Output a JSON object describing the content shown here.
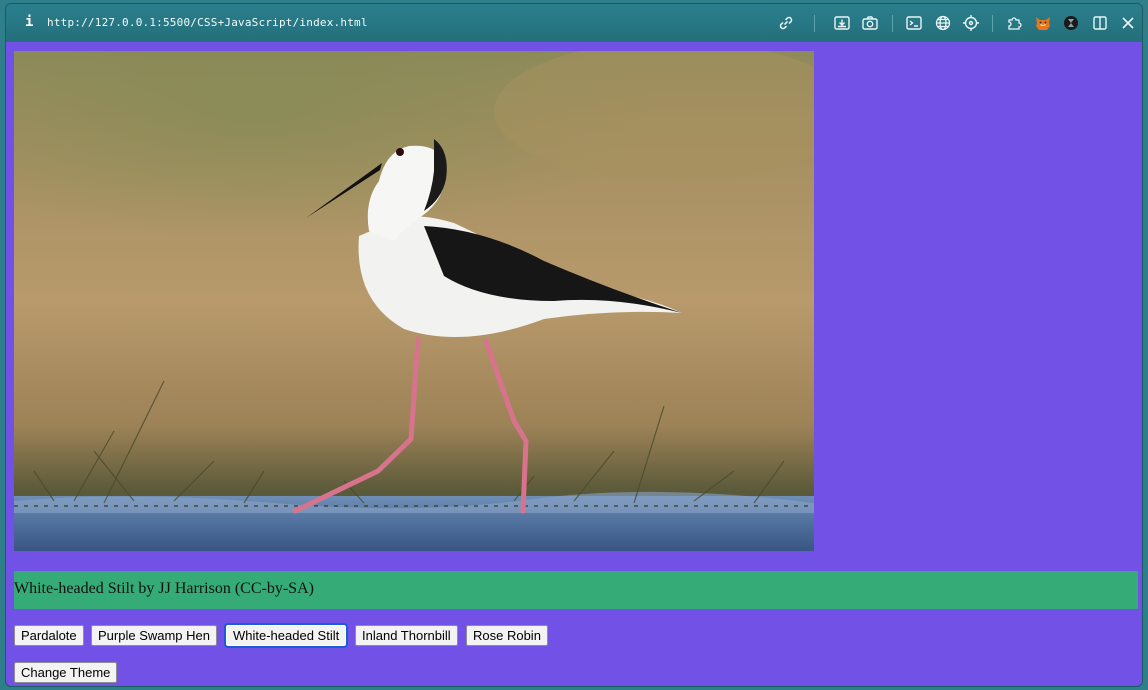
{
  "browser": {
    "url": "http://127.0.0.1:5500/CSS+JavaScript/index.html",
    "info_glyph": "i"
  },
  "toolbar_icons": [
    "link-icon",
    "download-icon",
    "camera-icon",
    "terminal-icon",
    "globe-icon",
    "crosshair-icon",
    "puzzle-icon",
    "fox-icon",
    "extension-icon",
    "split-view-icon",
    "close-icon"
  ],
  "colors": {
    "page_background": "#7251e6",
    "caption_background": "#35ab77",
    "urlbar": "#2b7f8d"
  },
  "image": {
    "alt": "White-headed Stilt"
  },
  "caption": {
    "text": "White-headed Stilt by JJ Harrison (CC-by-SA)"
  },
  "birds": {
    "buttons": [
      "Pardalote",
      "Purple Swamp Hen",
      "White-headed Stilt",
      "Inland Thornbill",
      "Rose Robin"
    ],
    "focused": "White-headed Stilt"
  },
  "theme": {
    "button_label": "Change Theme"
  }
}
